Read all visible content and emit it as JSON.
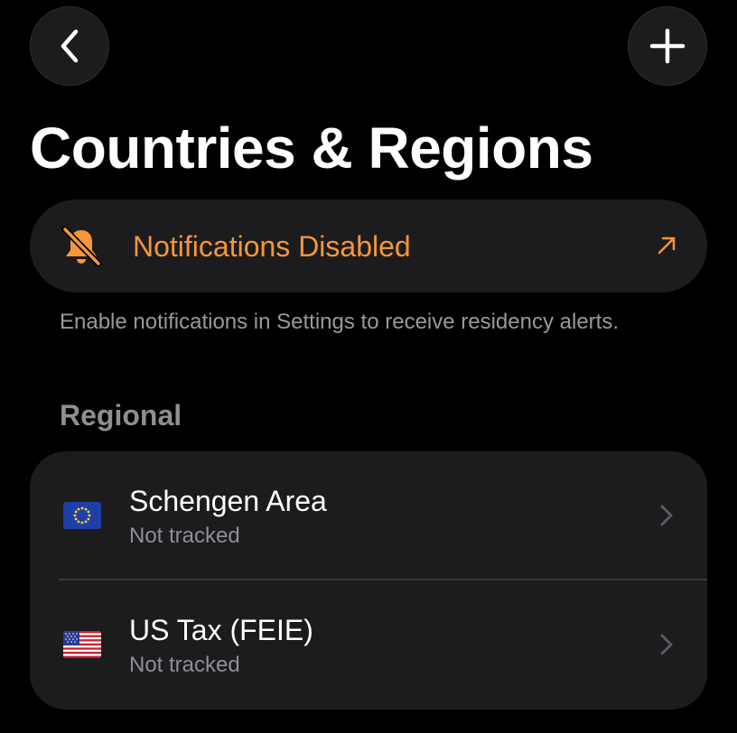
{
  "nav": {
    "back_icon": "chevron-left-icon",
    "add_icon": "plus-icon"
  },
  "page": {
    "title": "Countries & Regions"
  },
  "notifications": {
    "label": "Notifications Disabled",
    "icon": "bell-slash-icon",
    "action_icon": "arrow-up-right-icon",
    "accent_color": "#f5963a",
    "footer": "Enable notifications in Settings to receive residency alerts."
  },
  "sections": {
    "regional": {
      "header": "Regional",
      "items": [
        {
          "flag": "eu-flag-icon",
          "title": "Schengen Area",
          "status": "Not tracked"
        },
        {
          "flag": "us-flag-icon",
          "title": "US Tax (FEIE)",
          "status": "Not tracked"
        }
      ]
    }
  },
  "colors": {
    "background": "#000000",
    "card": "#1c1c1e",
    "secondary_text": "#8e8e93"
  }
}
